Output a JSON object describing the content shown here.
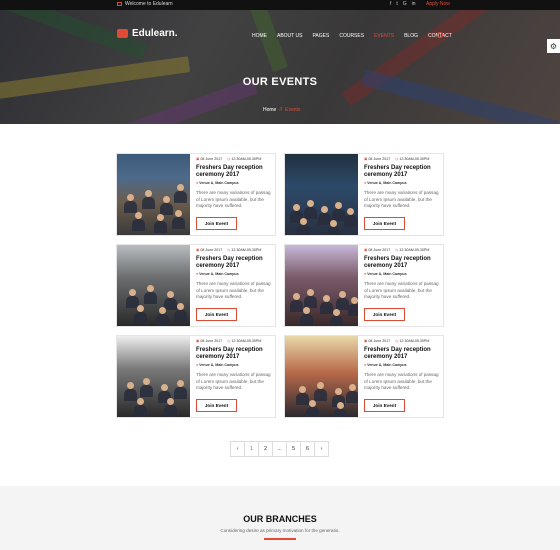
{
  "topbar": {
    "welcome": "Welcome to Edulearn",
    "social_icons": [
      "facebook-icon",
      "twitter-icon",
      "googleplus-icon",
      "linkedin-icon"
    ],
    "apply_label": "Apply Now"
  },
  "header": {
    "brand": "Edulearn.",
    "nav": [
      "HOME",
      "ABOUT US",
      "PAGES",
      "COURSES",
      "EVENTS",
      "BLOG",
      "CONTACT"
    ],
    "active_nav": "EVENTS"
  },
  "hero": {
    "title": "OUR EVENTS",
    "breadcrumb": {
      "home": "Home",
      "sep": "//",
      "current": "Events"
    }
  },
  "events": [
    {
      "date": "08 June 2017",
      "time": "12.30AM-05.30PM",
      "title": "Freshers Day reception ceremony 2017",
      "venue": "Venue A, Main Campus",
      "desc": "There are many variations of passag of Lorem Ipsum available, but the majority have suffered.",
      "button": "Join Event"
    },
    {
      "date": "08 June 2017",
      "time": "12.30AM-05.30PM",
      "title": "Freshers Day reception ceremony 2017",
      "venue": "Venue A, Main Campus",
      "desc": "There are many variations of passag of Lorem Ipsum available, but the majority have suffered.",
      "button": "Join Event"
    },
    {
      "date": "08 June 2017",
      "time": "12.30AM-05.30PM",
      "title": "Freshers Day reception ceremony 2017",
      "venue": "Venue A, Main Campus",
      "desc": "There are many variations of passag of Lorem Ipsum available, but the majority have suffered.",
      "button": "Join Event"
    },
    {
      "date": "08 June 2017",
      "time": "12.30AM-05.30PM",
      "title": "Freshers Day reception ceremony 2017",
      "venue": "Venue A, Main Campus",
      "desc": "There are many variations of passag of Lorem Ipsum available, but the majority have suffered.",
      "button": "Join Event"
    },
    {
      "date": "08 June 2017",
      "time": "12.30AM-05.30PM",
      "title": "Freshers Day reception ceremony 2017",
      "venue": "Venue A, Main Campus",
      "desc": "There are many variations of passag of Lorem Ipsum available, but the majority have suffered.",
      "button": "Join Event"
    },
    {
      "date": "08 June 2017",
      "time": "12.30AM-05.30PM",
      "title": "Freshers Day reception ceremony 2017",
      "venue": "Venue A, Main Campus",
      "desc": "There are many variations of passag of Lorem Ipsum available, but the majority have suffered.",
      "button": "Join Event"
    }
  ],
  "pagination": {
    "prev": "‹",
    "pages": [
      "1",
      "2",
      "...",
      "5",
      "6"
    ],
    "current": "1",
    "next": "›"
  },
  "branches": {
    "title": "OUR BRANCHES",
    "subtitle": "Considering desire as primary motivation for the generatio."
  },
  "colors": {
    "accent": "#e04b35",
    "topbar": "#111111",
    "section_bg": "#f4f4f4"
  }
}
